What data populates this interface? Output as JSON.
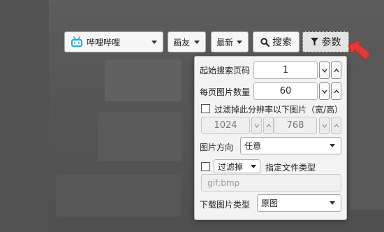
{
  "toolbar": {
    "site": "哔哩哔哩",
    "category": "画友",
    "sort": "最新",
    "search_label": "搜索",
    "params_label": "参数"
  },
  "panel": {
    "start_page": {
      "label": "起始搜索页码",
      "value": "1"
    },
    "per_page": {
      "label": "每页图片数量",
      "value": "60"
    },
    "filter_resolution": {
      "label": "过滤掉此分辨率以下图片（宽/高）",
      "checked": false,
      "width": "1024",
      "height": "768"
    },
    "orientation": {
      "label": "图片方向",
      "value": "任意"
    },
    "filter_type": {
      "checked": false,
      "mode": "过滤掉",
      "label": "指定文件类型",
      "placeholder": "gif;bmp"
    },
    "download_type": {
      "label": "下载图片类型",
      "value": "原图"
    }
  },
  "colors": {
    "bilibili_blue": "#23ade5",
    "arrow_red": "#e53935"
  },
  "icons": [
    "bilibili-logo-icon",
    "search-icon",
    "filter-icon",
    "chevron-down-icon",
    "chevron-up-icon",
    "red-arrow-icon"
  ]
}
